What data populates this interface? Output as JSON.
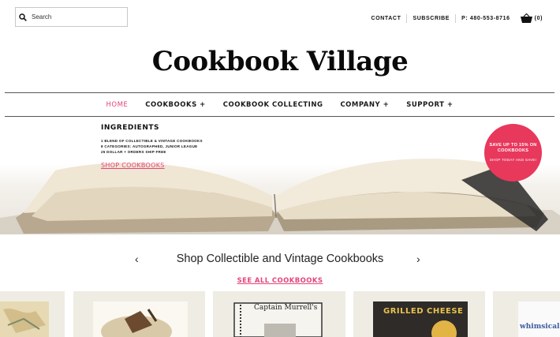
{
  "search": {
    "placeholder": "Search"
  },
  "util": {
    "contact": "CONTACT",
    "subscribe": "SUBSCRIBE",
    "phone": "P: 480-553-8716",
    "cart_count": "(0)"
  },
  "site": {
    "title": "Cookbook Village"
  },
  "nav": [
    {
      "label": "HOME"
    },
    {
      "label": "COOKBOOKS +"
    },
    {
      "label": "COOKBOOK COLLECTING"
    },
    {
      "label": "COMPANY +"
    },
    {
      "label": "SUPPORT +"
    }
  ],
  "hero": {
    "heading": "INGREDIENTS",
    "lines": [
      "1 BLEND OF COLLECTIBLE & VINTAGE COOKBOOKS",
      "8 CATEGORIES: AUTOGRAPHED, JUNIOR LEAGUE",
      "25 DOLLAR + ORDERS SHIP FREE"
    ],
    "cta": "SHOP COOKBOOKS",
    "badge_main": "SAVE UP TO 15% ON COOKBOOKS",
    "badge_sub": "SHOP TODAY AND SAVE!"
  },
  "section": {
    "title": "Shop Collectible and Vintage Cookbooks",
    "see_all": "SEE ALL COOKBOOKS",
    "prev": "‹",
    "next": "›"
  },
  "products": [
    {
      "cover_text": ""
    },
    {
      "cover_text": ""
    },
    {
      "cover_text": "Captain Murrell's"
    },
    {
      "cover_text": "GRILLED CHEESE"
    },
    {
      "cover_text": "whimsical"
    }
  ],
  "colors": {
    "accent": "#e4467a",
    "badge": "#e8385c",
    "card_bg": "#efece3"
  }
}
